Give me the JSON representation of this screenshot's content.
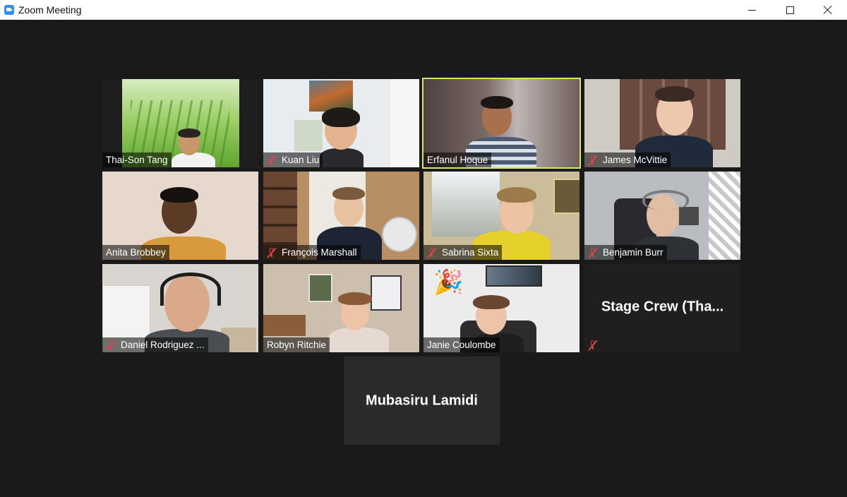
{
  "window": {
    "title": "Zoom Meeting",
    "controls": [
      "minimize",
      "maximize",
      "close"
    ]
  },
  "participants": [
    {
      "name": "Thai-Son Tang",
      "muted": false,
      "video": true,
      "active_speaker": false
    },
    {
      "name": "Kuan Liu",
      "muted": true,
      "video": true,
      "active_speaker": false
    },
    {
      "name": "Erfanul Hoque",
      "muted": false,
      "video": true,
      "active_speaker": true
    },
    {
      "name": "James McVittie",
      "muted": true,
      "video": true,
      "active_speaker": false
    },
    {
      "name": "Anita Brobbey",
      "muted": false,
      "video": true,
      "active_speaker": false
    },
    {
      "name": "François Marshall",
      "muted": true,
      "video": true,
      "active_speaker": false
    },
    {
      "name": "Sabrina Sixta",
      "muted": true,
      "video": true,
      "active_speaker": false
    },
    {
      "name": "Benjamin Burr",
      "muted": true,
      "video": true,
      "active_speaker": false
    },
    {
      "name": "Daniel Rodriguez ...",
      "muted": true,
      "video": true,
      "active_speaker": false
    },
    {
      "name": "Robyn Ritchie",
      "muted": false,
      "video": true,
      "active_speaker": false
    },
    {
      "name": "Janie Coulombe",
      "muted": false,
      "video": true,
      "active_speaker": false
    },
    {
      "name": "Stage Crew (Tha...",
      "muted": true,
      "video": false,
      "active_speaker": false
    },
    {
      "name": "Mubasiru Lamidi",
      "muted": false,
      "video": false,
      "active_speaker": false
    }
  ],
  "colors": {
    "background": "#1a1a1a",
    "active_border": "#d2e86a",
    "mute_red": "#e0424a",
    "title_bar": "#ffffff"
  }
}
